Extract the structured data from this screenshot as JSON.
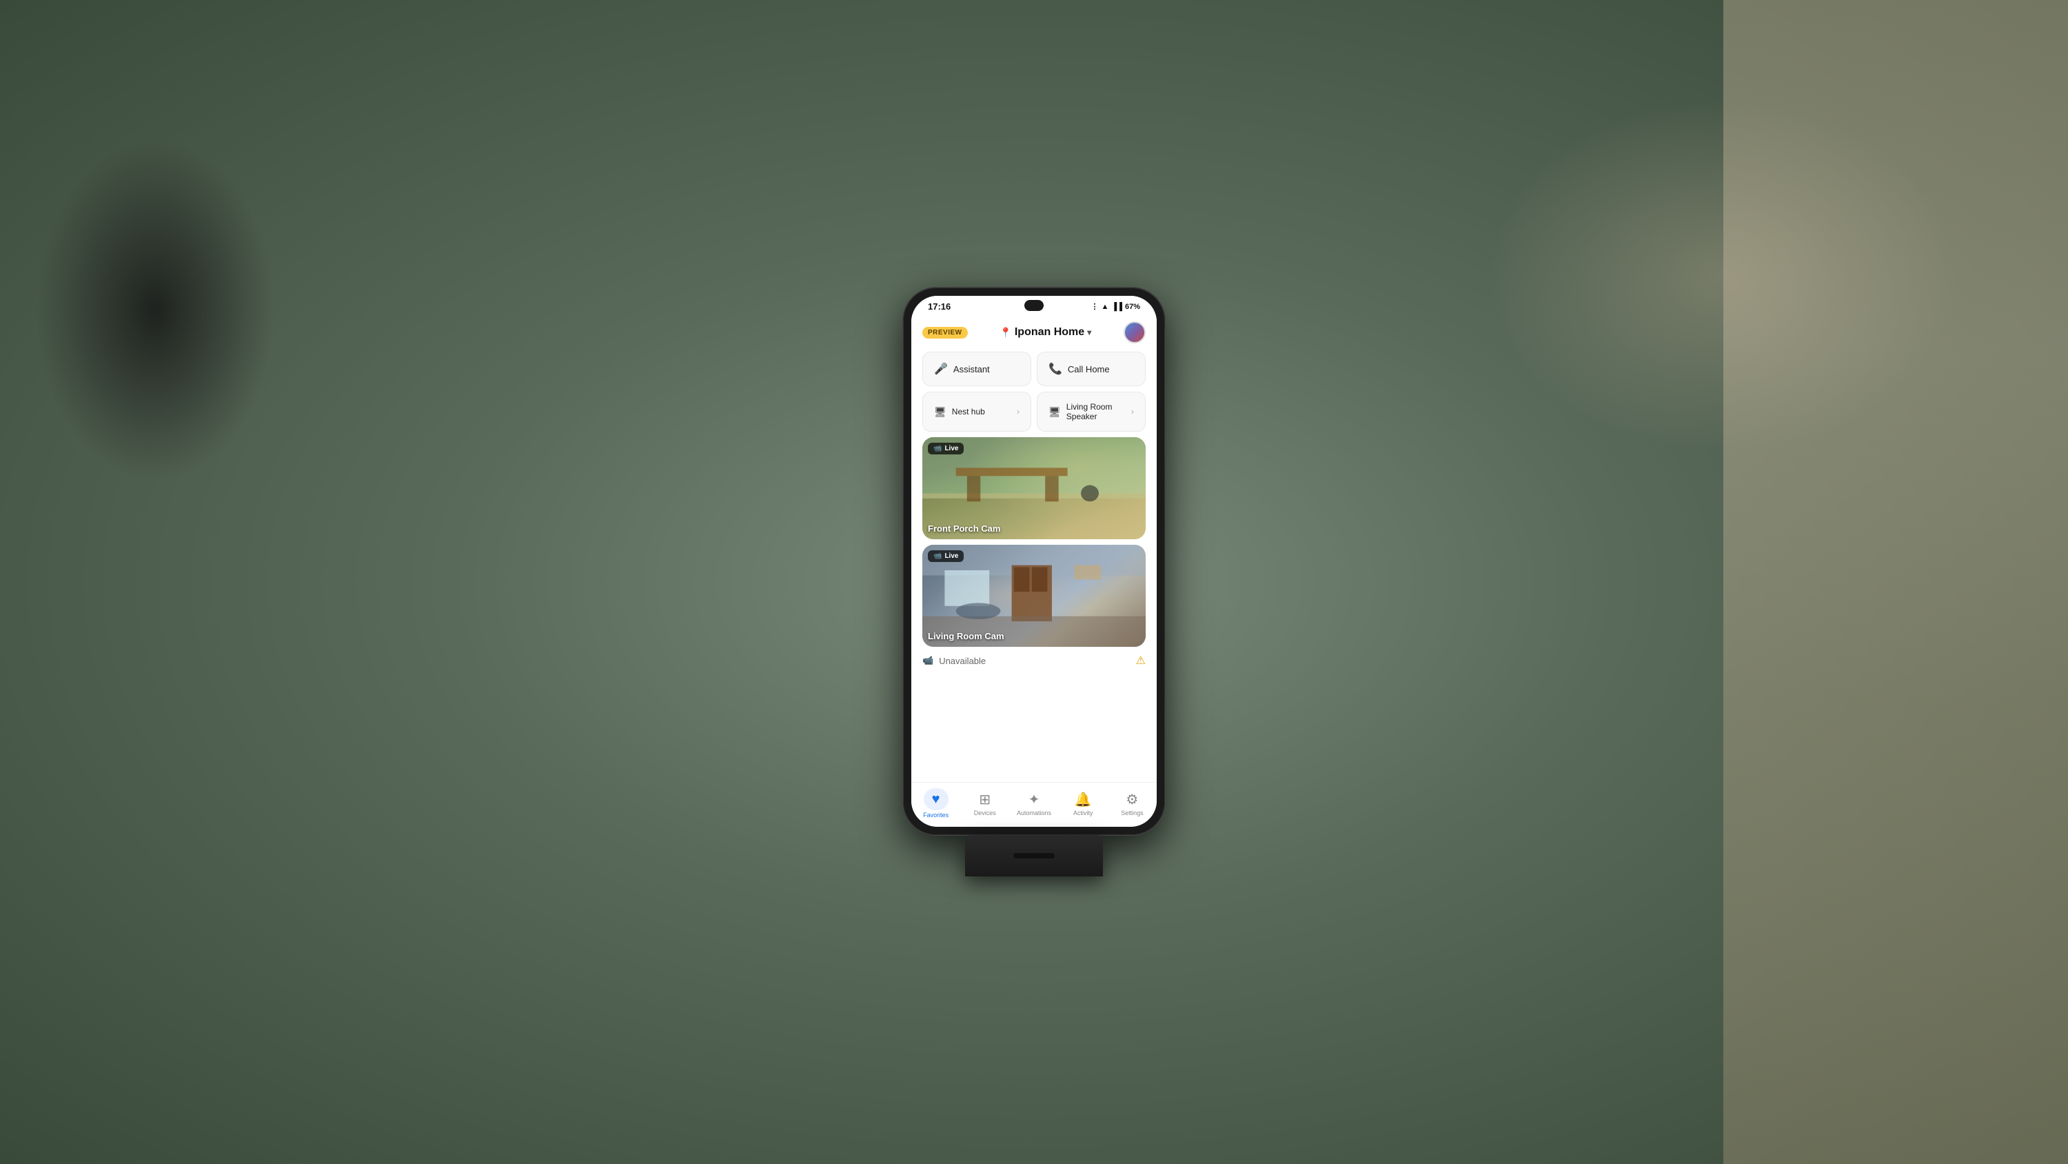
{
  "background": {
    "color": "#7a8a7a"
  },
  "status_bar": {
    "time": "17:16",
    "battery": "67%",
    "icons": [
      "bluetooth",
      "wifi",
      "signal"
    ]
  },
  "header": {
    "preview_label": "PREVIEW",
    "location_icon": "📍",
    "home_name": "Iponan Home",
    "chevron": "▾"
  },
  "quick_actions": [
    {
      "icon": "🎤",
      "label": "Assistant"
    },
    {
      "icon": "📞",
      "label": "Call Home"
    }
  ],
  "devices": [
    {
      "icon": "🖥",
      "label": "Nest hub"
    },
    {
      "icon": "🖥",
      "label": "Living Room Speaker"
    }
  ],
  "cameras": [
    {
      "id": "front-porch",
      "status": "Live",
      "label": "Front Porch Cam",
      "thumbnail_style": "outdoor"
    },
    {
      "id": "living-room",
      "status": "Live",
      "label": "Living Room Cam",
      "thumbnail_style": "indoor"
    }
  ],
  "unavailable": {
    "icon": "📹",
    "label": "Unavailable",
    "warning_icon": "⚠"
  },
  "bottom_nav": [
    {
      "icon": "♥",
      "label": "Favorites",
      "active": true
    },
    {
      "icon": "⊞",
      "label": "Devices",
      "active": false
    },
    {
      "icon": "✦",
      "label": "Automations",
      "active": false
    },
    {
      "icon": "🔔",
      "label": "Activity",
      "active": false
    },
    {
      "icon": "⚙",
      "label": "Settings",
      "active": false
    }
  ]
}
